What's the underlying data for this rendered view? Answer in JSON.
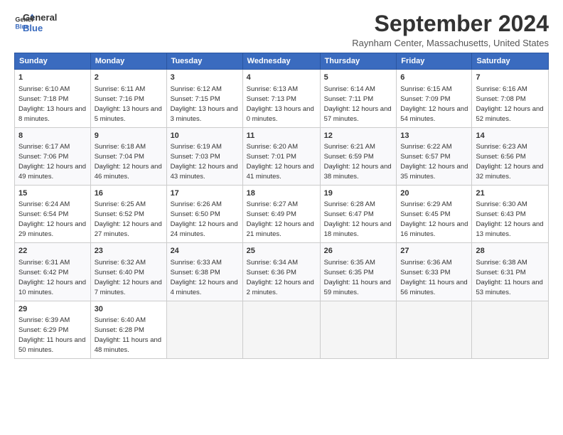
{
  "logo": {
    "line1": "General",
    "line2": "Blue"
  },
  "title": "September 2024",
  "subtitle": "Raynham Center, Massachusetts, United States",
  "days_of_week": [
    "Sunday",
    "Monday",
    "Tuesday",
    "Wednesday",
    "Thursday",
    "Friday",
    "Saturday"
  ],
  "weeks": [
    [
      {
        "day": 1,
        "sunrise": "6:10 AM",
        "sunset": "7:18 PM",
        "daylight": "13 hours and 8 minutes."
      },
      {
        "day": 2,
        "sunrise": "6:11 AM",
        "sunset": "7:16 PM",
        "daylight": "13 hours and 5 minutes."
      },
      {
        "day": 3,
        "sunrise": "6:12 AM",
        "sunset": "7:15 PM",
        "daylight": "13 hours and 3 minutes."
      },
      {
        "day": 4,
        "sunrise": "6:13 AM",
        "sunset": "7:13 PM",
        "daylight": "13 hours and 0 minutes."
      },
      {
        "day": 5,
        "sunrise": "6:14 AM",
        "sunset": "7:11 PM",
        "daylight": "12 hours and 57 minutes."
      },
      {
        "day": 6,
        "sunrise": "6:15 AM",
        "sunset": "7:09 PM",
        "daylight": "12 hours and 54 minutes."
      },
      {
        "day": 7,
        "sunrise": "6:16 AM",
        "sunset": "7:08 PM",
        "daylight": "12 hours and 52 minutes."
      }
    ],
    [
      {
        "day": 8,
        "sunrise": "6:17 AM",
        "sunset": "7:06 PM",
        "daylight": "12 hours and 49 minutes."
      },
      {
        "day": 9,
        "sunrise": "6:18 AM",
        "sunset": "7:04 PM",
        "daylight": "12 hours and 46 minutes."
      },
      {
        "day": 10,
        "sunrise": "6:19 AM",
        "sunset": "7:03 PM",
        "daylight": "12 hours and 43 minutes."
      },
      {
        "day": 11,
        "sunrise": "6:20 AM",
        "sunset": "7:01 PM",
        "daylight": "12 hours and 41 minutes."
      },
      {
        "day": 12,
        "sunrise": "6:21 AM",
        "sunset": "6:59 PM",
        "daylight": "12 hours and 38 minutes."
      },
      {
        "day": 13,
        "sunrise": "6:22 AM",
        "sunset": "6:57 PM",
        "daylight": "12 hours and 35 minutes."
      },
      {
        "day": 14,
        "sunrise": "6:23 AM",
        "sunset": "6:56 PM",
        "daylight": "12 hours and 32 minutes."
      }
    ],
    [
      {
        "day": 15,
        "sunrise": "6:24 AM",
        "sunset": "6:54 PM",
        "daylight": "12 hours and 29 minutes."
      },
      {
        "day": 16,
        "sunrise": "6:25 AM",
        "sunset": "6:52 PM",
        "daylight": "12 hours and 27 minutes."
      },
      {
        "day": 17,
        "sunrise": "6:26 AM",
        "sunset": "6:50 PM",
        "daylight": "12 hours and 24 minutes."
      },
      {
        "day": 18,
        "sunrise": "6:27 AM",
        "sunset": "6:49 PM",
        "daylight": "12 hours and 21 minutes."
      },
      {
        "day": 19,
        "sunrise": "6:28 AM",
        "sunset": "6:47 PM",
        "daylight": "12 hours and 18 minutes."
      },
      {
        "day": 20,
        "sunrise": "6:29 AM",
        "sunset": "6:45 PM",
        "daylight": "12 hours and 16 minutes."
      },
      {
        "day": 21,
        "sunrise": "6:30 AM",
        "sunset": "6:43 PM",
        "daylight": "12 hours and 13 minutes."
      }
    ],
    [
      {
        "day": 22,
        "sunrise": "6:31 AM",
        "sunset": "6:42 PM",
        "daylight": "12 hours and 10 minutes."
      },
      {
        "day": 23,
        "sunrise": "6:32 AM",
        "sunset": "6:40 PM",
        "daylight": "12 hours and 7 minutes."
      },
      {
        "day": 24,
        "sunrise": "6:33 AM",
        "sunset": "6:38 PM",
        "daylight": "12 hours and 4 minutes."
      },
      {
        "day": 25,
        "sunrise": "6:34 AM",
        "sunset": "6:36 PM",
        "daylight": "12 hours and 2 minutes."
      },
      {
        "day": 26,
        "sunrise": "6:35 AM",
        "sunset": "6:35 PM",
        "daylight": "11 hours and 59 minutes."
      },
      {
        "day": 27,
        "sunrise": "6:36 AM",
        "sunset": "6:33 PM",
        "daylight": "11 hours and 56 minutes."
      },
      {
        "day": 28,
        "sunrise": "6:38 AM",
        "sunset": "6:31 PM",
        "daylight": "11 hours and 53 minutes."
      }
    ],
    [
      {
        "day": 29,
        "sunrise": "6:39 AM",
        "sunset": "6:29 PM",
        "daylight": "11 hours and 50 minutes."
      },
      {
        "day": 30,
        "sunrise": "6:40 AM",
        "sunset": "6:28 PM",
        "daylight": "11 hours and 48 minutes."
      },
      null,
      null,
      null,
      null,
      null
    ]
  ]
}
